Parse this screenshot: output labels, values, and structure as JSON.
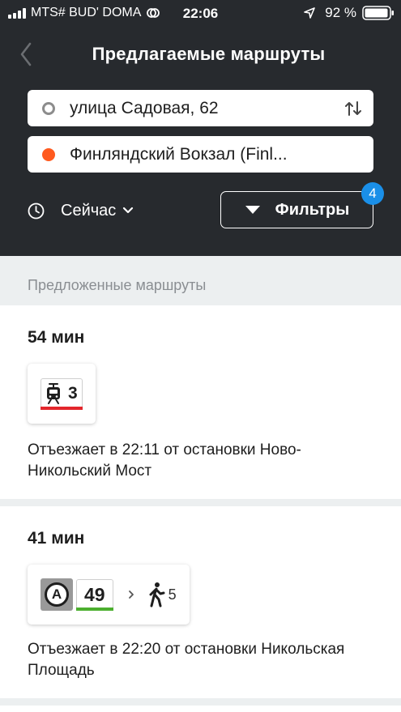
{
  "status_bar": {
    "carrier": "MTS# BUD' DOMA",
    "time": "22:06",
    "battery": "92 %"
  },
  "nav": {
    "title": "Предлагаемые маршруты"
  },
  "search": {
    "from": "улица Садовая, 62",
    "to": "Финляндский Вокзал (Finl..."
  },
  "options": {
    "time_label": "Сейчас",
    "filter_label": "Фильтры",
    "filter_count": "4"
  },
  "section": {
    "heading": "Предложенные маршруты"
  },
  "routes": [
    {
      "duration": "54 мин",
      "line_number": "3",
      "line_color": "#e3262b",
      "departure": "Отъезжает в 22:11 от остановки Ново-Никольский Мост"
    },
    {
      "duration": "41 мин",
      "bus_letter": "A",
      "line_number": "49",
      "line_color": "#4caf2f",
      "walk_minutes": "5",
      "departure": "Отъезжает в 22:20 от остановки Никольская Площадь"
    }
  ],
  "colors": {
    "header_bg": "#272a2e",
    "accent_badge": "#1a8fe8",
    "destination_dot": "#ff5a1f"
  }
}
